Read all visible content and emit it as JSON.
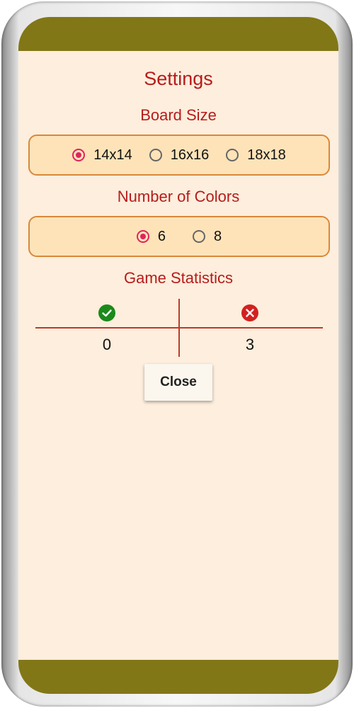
{
  "dialog": {
    "title": "Settings",
    "board_size": {
      "label": "Board Size",
      "options": [
        "14x14",
        "16x16",
        "18x18"
      ],
      "selected": "14x14"
    },
    "colors": {
      "label": "Number of Colors",
      "options": [
        "6",
        "8"
      ],
      "selected": "6"
    },
    "statistics": {
      "label": "Game Statistics",
      "wins_icon": "check-circle-icon",
      "losses_icon": "x-circle-icon",
      "wins": "0",
      "losses": "3"
    },
    "close_label": "Close"
  },
  "theme": {
    "bar_color": "#827717",
    "background": "#fdeedd",
    "accent": "#b71c1c",
    "option_box": "#ffe3b8",
    "option_border": "#d9883a",
    "radio_checked": "#e0245e",
    "win_color": "#1b8a1b",
    "loss_color": "#d32020"
  }
}
